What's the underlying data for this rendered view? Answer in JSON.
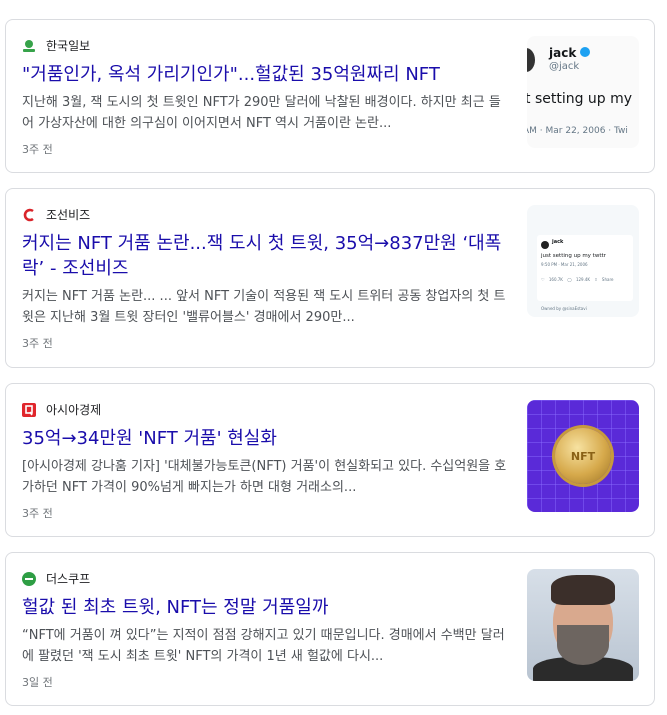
{
  "results": [
    {
      "source": "한국일보",
      "title": "\"거품인가, 옥석 가리기인가\"...헐값된 35억원짜리 NFT",
      "snippet": "지난해 3월, 잭 도시의 첫 트윗인 NFT가 290만 달러에 낙찰된 배경이다. 하지만 최근 들어 가상자산에 대한 의구심이 이어지면서 NFT 역시 거품이란 논란...",
      "time": "3주 전",
      "thumb": {
        "handle": "jack",
        "at": "@jack",
        "text": "t setting up my",
        "date": "AM · Mar 22, 2006 · Twi"
      }
    },
    {
      "source": "조선비즈",
      "title": "커지는 NFT 거품 논란...잭 도시 첫 트윗, 35억→837만원 ‘대폭락’ - 조선비즈",
      "snippet": "커지는 NFT 거품 논란... ... 앞서 NFT 기술이 적용된 잭 도시 트위터 공동 창업자의 첫 트윗은 지난해 3월 트윗 장터인 '밸류어블스' 경매에서 290만...",
      "time": "3주 전",
      "thumb": {
        "handle": "jack",
        "text": "just setting up my twttr",
        "date": "9:50 PM · Mar 21, 2006",
        "stats": "♡ 160.7K  ◯ 129.4K  ⇧ Share",
        "owner": "Owned by @sinaEstavi"
      }
    },
    {
      "source": "아시아경제",
      "title": "35억→34만원 'NFT 거품' 현실화",
      "snippet": "[아시아경제 강나훔 기자] '대체불가능토큰(NFT) 거품'이 현실화되고 있다. 수십억원을 호가하던 NFT 가격이 90%넘게 빠지는가 하면 대형 거래소의...",
      "time": "3주 전",
      "thumb": {
        "coin_text": "NFT"
      }
    },
    {
      "source": "더스쿠프",
      "title": "헐값 된 최초 트윗, NFT는 정말 거품일까",
      "snippet": "“NFT에 거품이 껴 있다”는 지적이 점점 강해지고 있기 때문입니다. 경매에서 수백만 달러에 팔렸던 '잭 도시 최초 트윗' NFT의 가격이 1년 새 헐값에 다시...",
      "time": "3일 전"
    }
  ],
  "colors": {
    "title": "#1a0dab",
    "snippet": "#4d5156",
    "border": "#dadce0",
    "hankook_logo": "#37a34a",
    "chosun_logo": "#d9242a",
    "asiae_logo": "#e0262c",
    "scoop_logo": "#2e9e44"
  },
  "icons": [
    "hankook-logo-icon",
    "chosun-logo-icon",
    "asiae-logo-icon",
    "scoop-logo-icon"
  ]
}
